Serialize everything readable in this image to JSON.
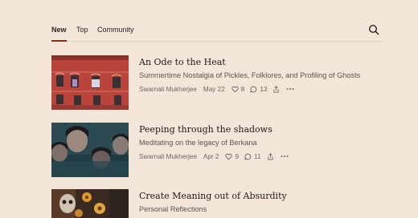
{
  "tabs": [
    {
      "label": "New",
      "active": true
    },
    {
      "label": "Top",
      "active": false
    },
    {
      "label": "Community",
      "active": false
    }
  ],
  "header": {
    "search_icon": "search-icon"
  },
  "posts": [
    {
      "title": "An Ode to the Heat",
      "subtitle": "Summertime Nostalgia of Pickles, Folklores, and Profiling of Ghosts",
      "author": "Swarnali Mukherjee",
      "date": "May 22",
      "likes": "8",
      "comments": "13"
    },
    {
      "title": "Peeping through the shadows",
      "subtitle": "Meditating on the legacy of Berkana",
      "author": "Swarnali Mukherjee",
      "date": "Apr 2",
      "likes": "9",
      "comments": "11"
    },
    {
      "title": "Create Meaning out of Absurdity",
      "subtitle": "Personal Reflections"
    }
  ],
  "colors": {
    "accent": "#8a2b1f",
    "background": "#f3e5d8"
  }
}
